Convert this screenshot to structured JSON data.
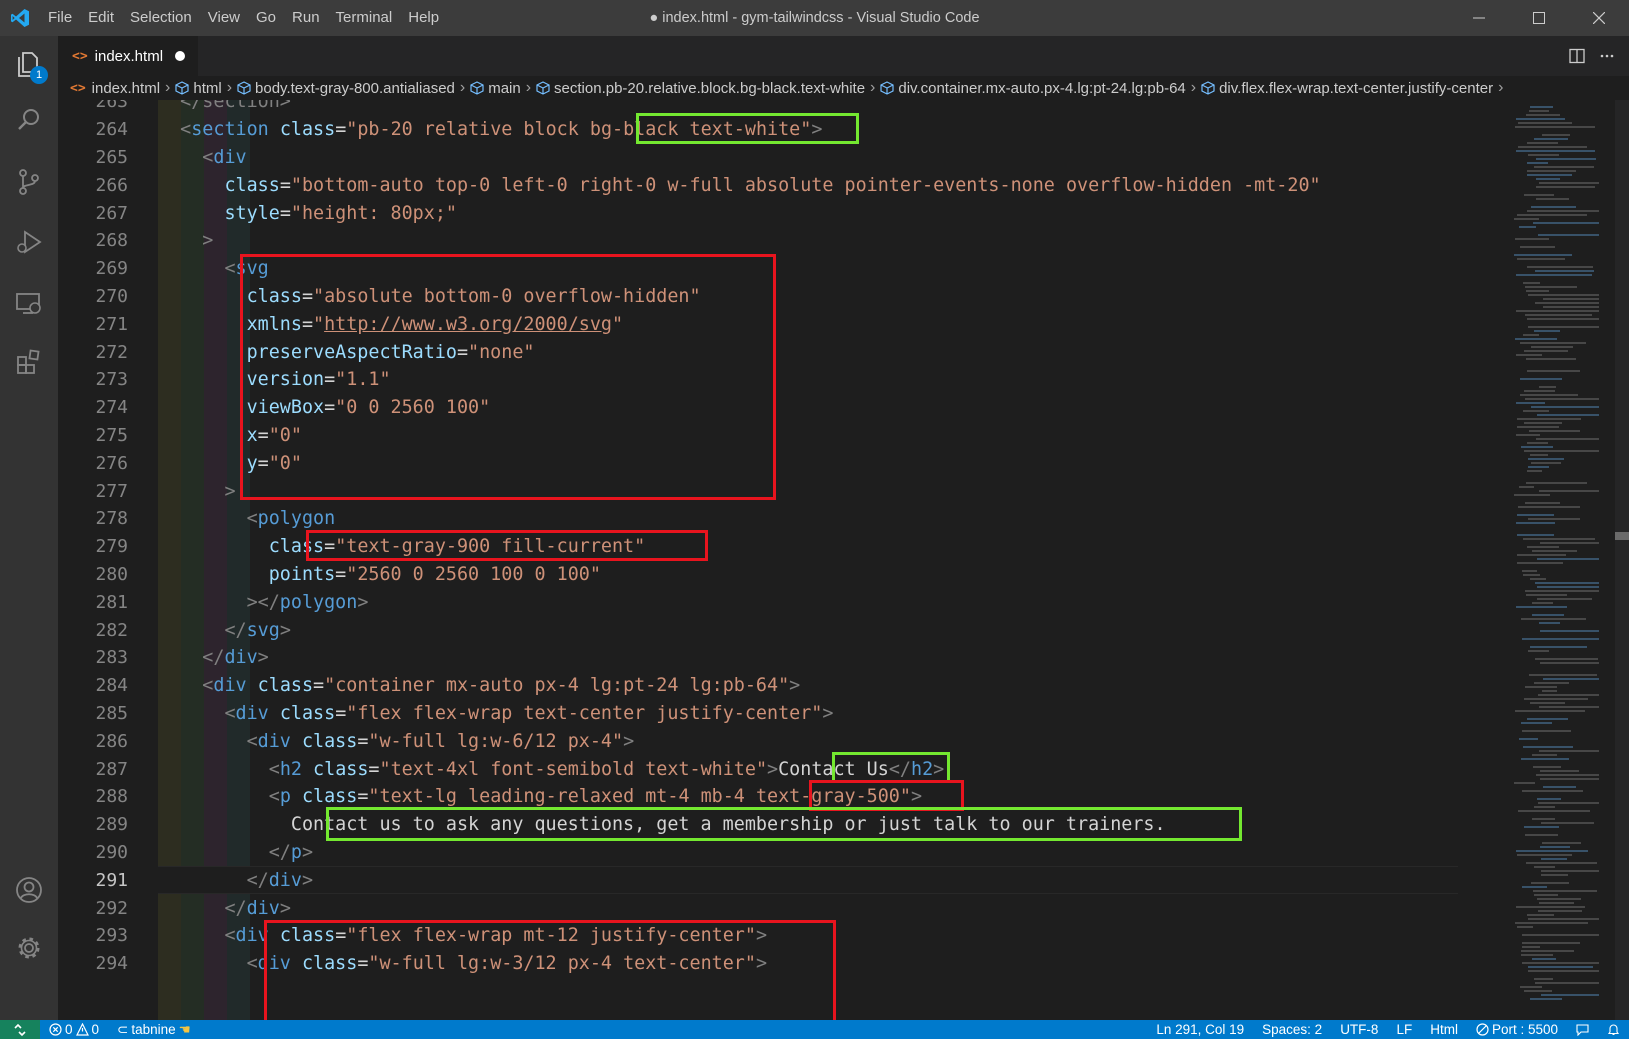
{
  "window": {
    "title": "● index.html - gym-tailwindcss - Visual Studio Code",
    "menu": [
      "File",
      "Edit",
      "Selection",
      "View",
      "Go",
      "Run",
      "Terminal",
      "Help"
    ]
  },
  "activity_bar": {
    "explorer_badge": "1",
    "icons": [
      "files-icon",
      "search-icon",
      "source-control-icon",
      "run-debug-icon",
      "remote-explorer-icon",
      "extensions-icon",
      "account-icon",
      "settings-gear-icon"
    ]
  },
  "tab": {
    "label": "index.html",
    "icon": "<>"
  },
  "breadcrumb": [
    "index.html",
    "html",
    "body.text-gray-800.antialiased",
    "main",
    "section.pb-20.relative.block.bg-black.text-white",
    "div.container.mx-auto.px-4.lg:pt-24.lg:pb-64",
    "div.flex.flex-wrap.text-center.justify-center"
  ],
  "editor": {
    "line_numbers": [
      "263",
      "264",
      "265",
      "266",
      "267",
      "268",
      "269",
      "270",
      "271",
      "272",
      "273",
      "274",
      "275",
      "276",
      "277",
      "278",
      "279",
      "280",
      "281",
      "282",
      "283",
      "284",
      "285",
      "286",
      "287",
      "288",
      "289",
      "290",
      "291",
      "292",
      "293",
      "294"
    ],
    "current_line": "291",
    "lines": {
      "l263": {
        "i": "  ",
        "a": "</section>"
      },
      "l264": {
        "i": "  ",
        "p1": "<",
        "tag": "section",
        "sp": " ",
        "attr": "class",
        "eq": "=",
        "val": "\"pb-20 relative block bg-black text-white\"",
        "p2": ">"
      },
      "l265": {
        "i": "    ",
        "p1": "<",
        "tag": "div"
      },
      "l266": {
        "i": "      ",
        "attr": "class",
        "eq": "=",
        "val": "\"bottom-auto top-0 left-0 right-0 w-full absolute pointer-events-none overflow-hidden -mt-20\""
      },
      "l267": {
        "i": "      ",
        "attr": "style",
        "eq": "=",
        "val": "\"height: 80px;\""
      },
      "l268": {
        "i": "    ",
        "p1": ">"
      },
      "l269": {
        "i": "      ",
        "p1": "<",
        "tag": "svg"
      },
      "l270": {
        "i": "        ",
        "attr": "class",
        "eq": "=",
        "val": "\"absolute bottom-0 overflow-hidden\""
      },
      "l271": {
        "i": "        ",
        "attr": "xmlns",
        "eq": "=",
        "q1": "\"",
        "link": "http://www.w3.org/2000/svg",
        "q2": "\""
      },
      "l272": {
        "i": "        ",
        "attr": "preserveAspectRatio",
        "eq": "=",
        "val": "\"none\""
      },
      "l273": {
        "i": "        ",
        "attr": "version",
        "eq": "=",
        "val": "\"1.1\""
      },
      "l274": {
        "i": "        ",
        "attr": "viewBox",
        "eq": "=",
        "val": "\"0 0 2560 100\""
      },
      "l275": {
        "i": "        ",
        "attr": "x",
        "eq": "=",
        "val": "\"0\""
      },
      "l276": {
        "i": "        ",
        "attr": "y",
        "eq": "=",
        "val": "\"0\""
      },
      "l277": {
        "i": "      ",
        "p1": ">"
      },
      "l278": {
        "i": "        ",
        "p1": "<",
        "tag": "polygon"
      },
      "l279": {
        "i": "          ",
        "attr": "class",
        "eq": "=",
        "val": "\"text-gray-900 fill-current\""
      },
      "l280": {
        "i": "          ",
        "attr": "points",
        "eq": "=",
        "val": "\"2560 0 2560 100 0 100\""
      },
      "l281": {
        "i": "        ",
        "p1": "></",
        "tag": "polygon",
        "p2": ">"
      },
      "l282": {
        "i": "      ",
        "p1": "</",
        "tag": "svg",
        "p2": ">"
      },
      "l283": {
        "i": "    ",
        "p1": "</",
        "tag": "div",
        "p2": ">"
      },
      "l284": {
        "i": "    ",
        "p1": "<",
        "tag": "div",
        "sp": " ",
        "attr": "class",
        "eq": "=",
        "val": "\"container mx-auto px-4 lg:pt-24 lg:pb-64\"",
        "p2": ">"
      },
      "l285": {
        "i": "      ",
        "p1": "<",
        "tag": "div",
        "sp": " ",
        "attr": "class",
        "eq": "=",
        "val": "\"flex flex-wrap text-center justify-center\"",
        "p2": ">"
      },
      "l286": {
        "i": "        ",
        "p1": "<",
        "tag": "div",
        "sp": " ",
        "attr": "class",
        "eq": "=",
        "val": "\"w-full lg:w-6/12 px-4\"",
        "p2": ">"
      },
      "l287": {
        "i": "          ",
        "p1": "<",
        "tag": "h2",
        "sp": " ",
        "attr": "class",
        "eq": "=",
        "val": "\"text-4xl font-semibold text-white\"",
        "p2": ">",
        "text": "Contact Us",
        "p3": "</",
        "tag2": "h2",
        "p4": ">"
      },
      "l288": {
        "i": "          ",
        "p1": "<",
        "tag": "p",
        "sp": " ",
        "attr": "class",
        "eq": "=",
        "val": "\"text-lg leading-relaxed mt-4 mb-4 text-gray-500\"",
        "p2": ">"
      },
      "l289": {
        "i": "            ",
        "text": "Contact us to ask any questions, get a membership or just talk to our trainers."
      },
      "l290": {
        "i": "          ",
        "p1": "</",
        "tag": "p",
        "p2": ">"
      },
      "l291": {
        "i": "        ",
        "p1": "</",
        "tag": "div",
        "p2": ">"
      },
      "l292": {
        "i": "      ",
        "p1": "</",
        "tag": "div",
        "p2": ">"
      },
      "l293": {
        "i": "      ",
        "p1": "<",
        "tag": "div",
        "sp": " ",
        "attr": "class",
        "eq": "=",
        "val": "\"flex flex-wrap mt-12 justify-center\"",
        "p2": ">"
      },
      "l294": {
        "i": "        ",
        "p1": "<",
        "tag": "div",
        "sp": " ",
        "attr": "class",
        "eq": "=",
        "val": "\"w-full lg:w-3/12 px-4 text-center\"",
        "p2": ">"
      }
    }
  },
  "status_bar": {
    "errors": "0",
    "warnings": "0",
    "tabnine": "tabnine",
    "position": "Ln 291, Col 19",
    "spaces": "Spaces: 2",
    "encoding": "UTF-8",
    "eol": "LF",
    "language": "Html",
    "port": "Port : 5500"
  },
  "colors": {
    "annotation_red": "#e8141e",
    "annotation_green": "#74e830",
    "accent": "#007acc"
  }
}
